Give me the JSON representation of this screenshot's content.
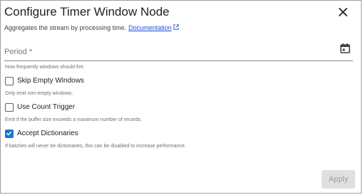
{
  "dialog": {
    "title": "Configure Timer Window Node",
    "subtitle": "Aggregates the stream by processing time.",
    "doc_link": "Documentation",
    "close_icon": "close-icon"
  },
  "period": {
    "label": "Period *",
    "value": "",
    "help": "How frequently windows should fire.",
    "icon": "calendar-icon"
  },
  "options": [
    {
      "label": "Skip Empty Windows",
      "help": "Only emit non-empty windows.",
      "checked": false
    },
    {
      "label": "Use Count Trigger",
      "help": "Emit if the buffer size exceeds a maximum number of records.",
      "checked": false
    },
    {
      "label": "Accept Dictionaries",
      "help": "If batches will never be dictionaries, this can be disabled to increase performance.",
      "checked": true
    }
  ],
  "footer": {
    "apply_label": "Apply",
    "apply_enabled": false
  },
  "colors": {
    "accent": "#1976d2",
    "link": "#1a4fd6",
    "disabled_bg": "#e0e0e0",
    "disabled_text": "#9e9e9e"
  }
}
